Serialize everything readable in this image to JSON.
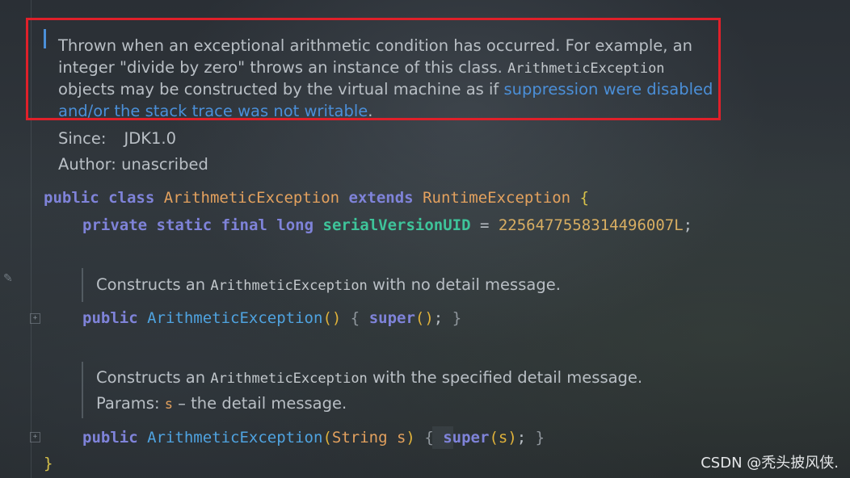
{
  "doc_main": {
    "line1": "Thrown when an exceptional arithmetic condition has occurred. For example, an",
    "line2_text": "integer \"divide by zero\" throws an instance of this class. ",
    "line2_code": "ArithmeticException",
    "line3_text": "objects may be constructed by the virtual machine as if ",
    "line3_link": "suppression were disabled",
    "line4_link": "and/or the stack trace was not writable",
    "line4_tail": ".",
    "since_label": "Since:",
    "since_value": "JDK1.0",
    "author_label": "Author:",
    "author_value": "unascribed"
  },
  "code": {
    "kw_public": "public",
    "kw_class": "class",
    "class_name": "ArithmeticException",
    "kw_extends": "extends",
    "super_class": "RuntimeException",
    "open_brace": "{",
    "kw_private": "private",
    "kw_static": "static",
    "kw_final": "final",
    "kw_long": "long",
    "field_name": "serialVersionUID",
    "equals": " = ",
    "field_value": "2256477558314496007L",
    "semicolon": ";",
    "close_brace": "}"
  },
  "ctor1": {
    "doc_prefix": "Constructs an ",
    "doc_code": "ArithmeticException",
    "doc_suffix": " with no detail message.",
    "kw_public": "public",
    "name": "ArithmeticException",
    "parens": "()",
    "lbrace": "{",
    "kw_super": "super",
    "call": "()",
    "semi": ";",
    "rbrace": "}"
  },
  "ctor2": {
    "doc_prefix": "Constructs an ",
    "doc_code": "ArithmeticException",
    "doc_suffix": " with the specified detail message.",
    "params_label": "Params:",
    "param_name": "s",
    "param_desc": " – the detail message.",
    "kw_public": "public",
    "name": "ArithmeticException",
    "lparen": "(",
    "param_type": "String",
    "param": " s",
    "rparen": ")",
    "lbrace": "{",
    "kw_super": "super",
    "call": "(s)",
    "semi": ";",
    "rbrace": "}"
  },
  "icons": {
    "fold1": "fold-expand-icon",
    "fold2": "fold-expand-icon",
    "edit": "pencil-icon"
  },
  "watermark": "CSDN @秃头披风侠.",
  "colors": {
    "keyword": "#7f83d9",
    "class": "#e3a15e",
    "field": "#3ec49a",
    "number": "#d8ae62",
    "link": "#4b8fd8",
    "annotation_border": "#e0202a"
  }
}
